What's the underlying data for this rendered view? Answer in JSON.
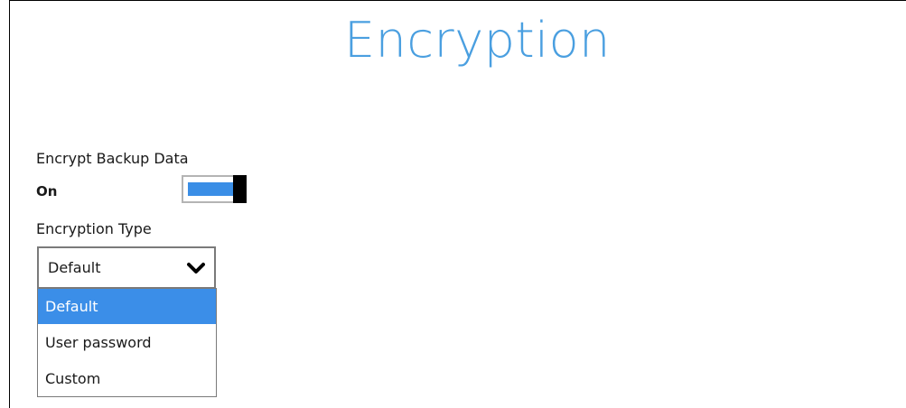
{
  "page": {
    "title": "Encryption"
  },
  "encrypt_backup": {
    "label": "Encrypt Backup Data",
    "state_label": "On",
    "enabled": true
  },
  "encryption_type": {
    "label": "Encryption Type",
    "selected": "Default",
    "options": [
      "Default",
      "User password",
      "Custom"
    ],
    "highlighted_index": 0
  },
  "icons": {
    "dropdown": "chevron-down-icon"
  },
  "colors": {
    "title": "#4a9fe0",
    "toggle_fill": "#3a8ee6",
    "toggle_knob": "#000000",
    "option_highlight": "#3b8ee8",
    "option_highlight_text": "#ffffff"
  }
}
